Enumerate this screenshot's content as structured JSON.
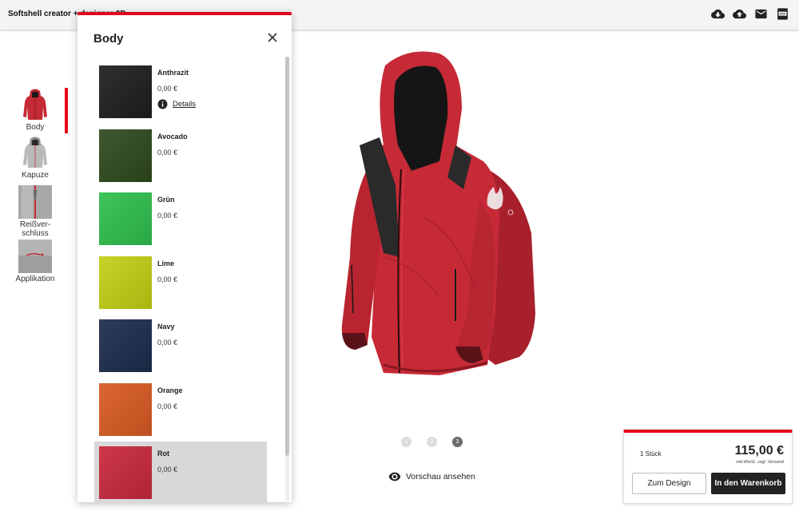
{
  "app": {
    "title": "Softshell creator + designer 3D"
  },
  "toolbar": {
    "icons": [
      "cloud-download-icon",
      "cloud-upload-icon",
      "mail-icon",
      "pdf-icon"
    ]
  },
  "nav": {
    "items": [
      {
        "label": "Body",
        "icon": "jacket-body-thumb"
      },
      {
        "label": "Kapuze",
        "icon": "jacket-hood-thumb"
      },
      {
        "label": "Reißver-\nschluss",
        "label_line1": "Reißver-",
        "label_line2": "schluss",
        "icon": "zipper-thumb"
      },
      {
        "label": "Applikation",
        "icon": "applikation-thumb"
      }
    ],
    "active": "Body"
  },
  "panel": {
    "title": "Body",
    "details_label": "Details",
    "colors": [
      {
        "name": "Anthrazit",
        "price": "0,00 €",
        "color": "#1e1e1e"
      },
      {
        "name": "Avocado",
        "price": "0,00 €",
        "color": "#2f4a1e"
      },
      {
        "name": "Grün",
        "price": "0,00 €",
        "color": "#2fbf4d"
      },
      {
        "name": "Lime",
        "price": "0,00 €",
        "color": "#c2cf14"
      },
      {
        "name": "Navy",
        "price": "0,00 €",
        "color": "#1c2c4c"
      },
      {
        "name": "Orange",
        "price": "0,00 €",
        "color": "#d85a22"
      },
      {
        "name": "Rot",
        "price": "0,00 €",
        "color": "#c8283c"
      }
    ],
    "selected": "Rot"
  },
  "preview": {
    "pages": [
      "1",
      "2",
      "3"
    ],
    "active_page": "3",
    "label": "Vorschau ansehen"
  },
  "cart": {
    "quantity": "1 Stück",
    "price": "115,00 €",
    "tax_note": "inkl.MwSt. zzgl. Versand",
    "design_button": "Zum Design",
    "cart_button": "In den Warenkorb"
  },
  "colors": {
    "accent": "#e3061a",
    "jacket": "#c62a36"
  }
}
